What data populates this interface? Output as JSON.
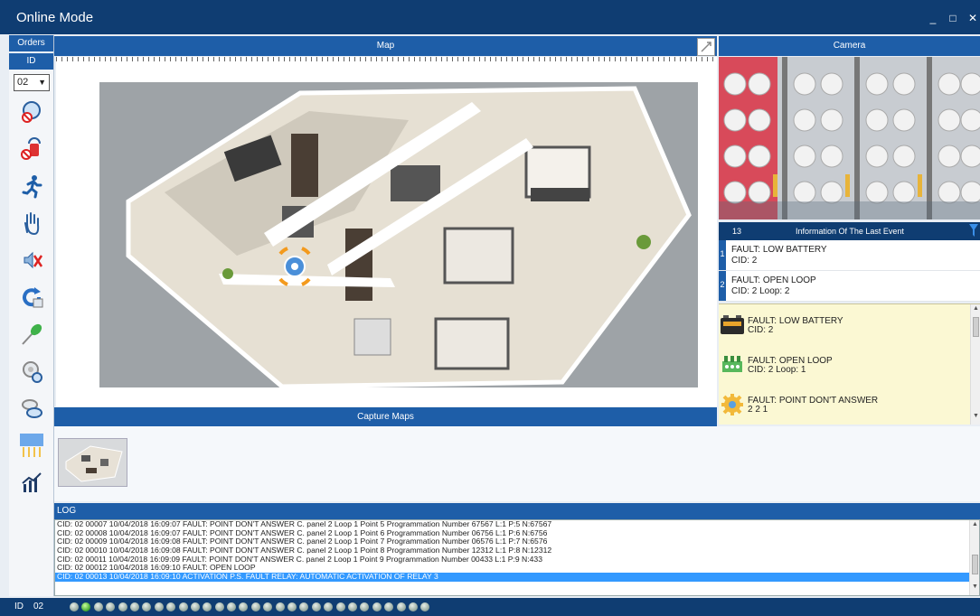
{
  "window": {
    "title": "Online Mode",
    "minimize": "_",
    "maximize": "□",
    "close": "✕"
  },
  "left": {
    "orders_label": "Orders",
    "id_label": "ID",
    "id_value": "02",
    "tools": [
      "zone-disable-icon",
      "siren-silence-icon",
      "evacuate-icon",
      "hand-stop-icon",
      "mute-buzzer-icon",
      "reset-icon",
      "led-test-icon",
      "detector-icon",
      "detector-test-icon",
      "map-view-icon",
      "statistics-icon"
    ]
  },
  "map": {
    "header": "Map"
  },
  "camera": {
    "header": "Camera"
  },
  "capture": {
    "header": "Capture Maps"
  },
  "last_event": {
    "count": "13",
    "title": "Information Of The Last Event",
    "items": [
      {
        "num": "1",
        "line1": "FAULT: LOW BATTERY",
        "line2": "CID: 2"
      },
      {
        "num": "2",
        "line1": "FAULT: OPEN LOOP",
        "line2": "CID: 2 Loop: 2"
      }
    ]
  },
  "faults": [
    {
      "icon": "battery-icon",
      "line1": "FAULT: LOW BATTERY",
      "line2": "CID: 2"
    },
    {
      "icon": "loop-connector-icon",
      "line1": "FAULT: OPEN LOOP",
      "line2": "CID: 2 Loop: 1"
    },
    {
      "icon": "gear-icon",
      "line1": "FAULT: POINT DON'T ANSWER",
      "line2": "2 2 1"
    }
  ],
  "log": {
    "header": "LOG",
    "lines": [
      "CID: 02 00007 10/04/2018 16:09:07 FAULT: POINT DON'T ANSWER C. panel 2 Loop 1 Point 5 Programmation Number 67567 L:1 P:5 N:67567",
      "CID: 02 00008 10/04/2018 16:09:07 FAULT: POINT DON'T ANSWER C. panel 2 Loop 1 Point 6 Programmation Number 06756 L:1 P:6 N:6756",
      "CID: 02 00009 10/04/2018 16:09:08 FAULT: POINT DON'T ANSWER C. panel 2 Loop 1 Point 7 Programmation Number 06576 L:1 P:7 N:6576",
      "CID: 02 00010 10/04/2018 16:09:08 FAULT: POINT DON'T ANSWER C. panel 2 Loop 1 Point 8 Programmation Number 12312 L:1 P:8 N:12312",
      "CID: 02 00011 10/04/2018 16:09:09 FAULT: POINT DON'T ANSWER C. panel 2 Loop 1 Point 9 Programmation Number 00433 L:1 P:9 N:433",
      "CID: 02 00012 10/04/2018 16:09:10 FAULT: OPEN LOOP",
      "CID: 02 00013 10/04/2018 16:09:10 ACTIVATION P.S. FAULT RELAY: AUTOMATIC ACTIVATION OF RELAY 3"
    ],
    "selected_index": 6
  },
  "status": {
    "id_label": "ID",
    "id_value": "02",
    "indicator_count": 30,
    "active_index": 1
  },
  "colors": {
    "titlebar": "#0f3d72",
    "panel_header": "#1e5ea8",
    "fault_bg": "#fbf8d3",
    "selection": "#3399ff"
  }
}
